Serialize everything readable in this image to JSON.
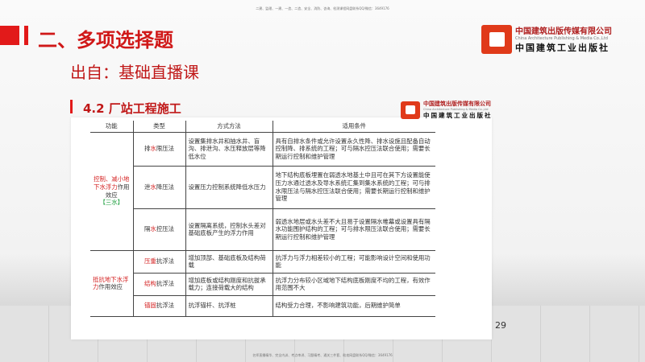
{
  "top_note": "二建、监理、一建、一造、二造、安全、消防、咨询、检测课程网盘联系QQ/微信：3649176",
  "bottom_note": "名师直播精华、完全内训、考点串讲、习题精考、通关三件套、助攻网盘联系QQ/微信：3649176",
  "title": "二、多项选择题",
  "subtitle": "出自：基础直播课",
  "section": "4.2 厂站工程施工",
  "logo": {
    "cn": "中国建筑出版传媒有限公司",
    "en": "China Architecture Publishing & Media Co.,Ltd",
    "cn2": "中国建筑工业出版社"
  },
  "table": {
    "headers": [
      "功能",
      "类型",
      "方式方法",
      "适用条件"
    ],
    "group1": {
      "red": "控制、减小地下水浮力",
      "rest": "作用效应",
      "tag": "【三水】"
    },
    "group2": {
      "red": "抵抗地下水浮力",
      "rest": "作用效应"
    },
    "rows": [
      {
        "t1": "排",
        "t2": "水",
        "t3": "限压法",
        "method": "设置集排水井和抽水井、盲沟、排泄沟、水压释放层等降低水位",
        "cond": "具有自排水条件或允许设置永久性降、排水设施且配备自动控制降、排系统的工程；可与隔水控压法联合使用；需要长期运行控制和维护管理"
      },
      {
        "t1": "泄",
        "t2": "水",
        "t3": "降压法",
        "method": "设置压力控制系统降低水压力",
        "cond": "地下结构底板埋置在弱透水地基土中且可在其下方设置能使压力水通过透水及导水系统汇集到集水系统的工程；可与排水限压法与隔水控压法联合使用；需要长期运行控制和维护管理"
      },
      {
        "t1": "隔",
        "t2": "水",
        "t3": "控压法",
        "method": "设置隔离系统，控制水头差对基础底板产生的浮力作用",
        "cond": "弱透水地层或水头差不大且易于设置隔水帷幕或设置具有隔水功能围护结构的工程；可与排水限压法联合使用；需要长期运行控制和维护管理"
      },
      {
        "t1": "",
        "t2": "压重",
        "t3": "抗浮法",
        "method": "增加顶部、基础底板及结构荷载",
        "cond": "抗浮力与浮力相差较小的工程；可能影响设计空间和使用功能"
      },
      {
        "t1": "",
        "t2": "结构",
        "t3": "抗浮法",
        "method": "增加底板或结构刚度和抗拔承载力；连接荷载大的结构",
        "cond": "抗浮力分布较小区域地下结构底板刚度不均的工程，有效作用范围不大"
      },
      {
        "t1": "",
        "t2": "锚固",
        "t3": "抗浮法",
        "method": "抗浮锚杆、抗浮桩",
        "cond": "结构受力合理，不影响建筑功能，后期维护简单"
      }
    ]
  },
  "page_number": "29"
}
